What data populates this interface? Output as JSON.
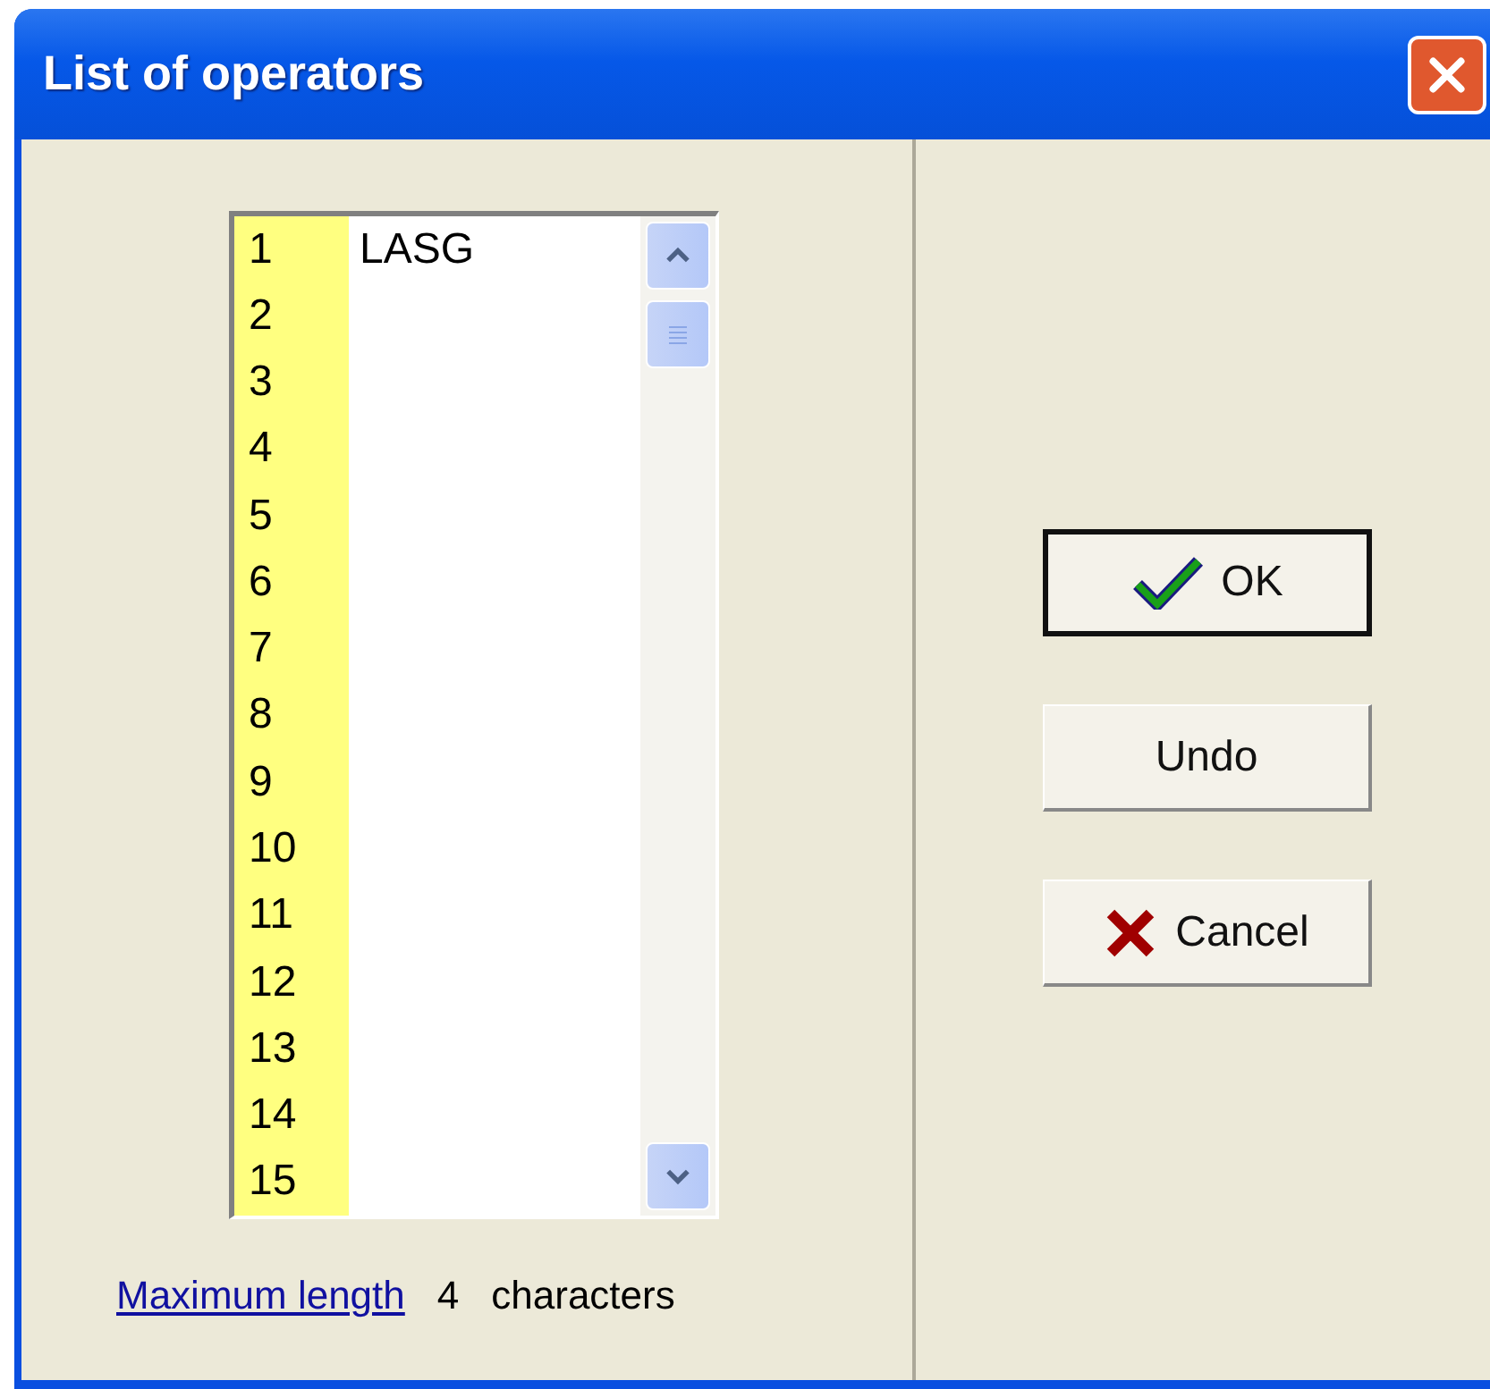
{
  "window": {
    "title": "List of operators"
  },
  "list": {
    "rows": [
      {
        "number": "1",
        "value": "LASG"
      },
      {
        "number": "2"
      },
      {
        "number": "3"
      },
      {
        "number": "4"
      },
      {
        "number": "5"
      },
      {
        "number": "6"
      },
      {
        "number": "7"
      },
      {
        "number": "8"
      },
      {
        "number": "9"
      },
      {
        "number": "10"
      },
      {
        "number": "11"
      },
      {
        "number": "12"
      },
      {
        "number": "13"
      },
      {
        "number": "14"
      },
      {
        "number": "15"
      }
    ]
  },
  "max_length": {
    "link": "Maximum length",
    "value": "4",
    "unit": "characters"
  },
  "buttons": [
    {
      "label": "OK",
      "kind": "ok",
      "default": true
    },
    {
      "label": "Undo",
      "kind": "plain",
      "default": false
    },
    {
      "label": "Cancel",
      "kind": "cancel",
      "default": false
    }
  ]
}
